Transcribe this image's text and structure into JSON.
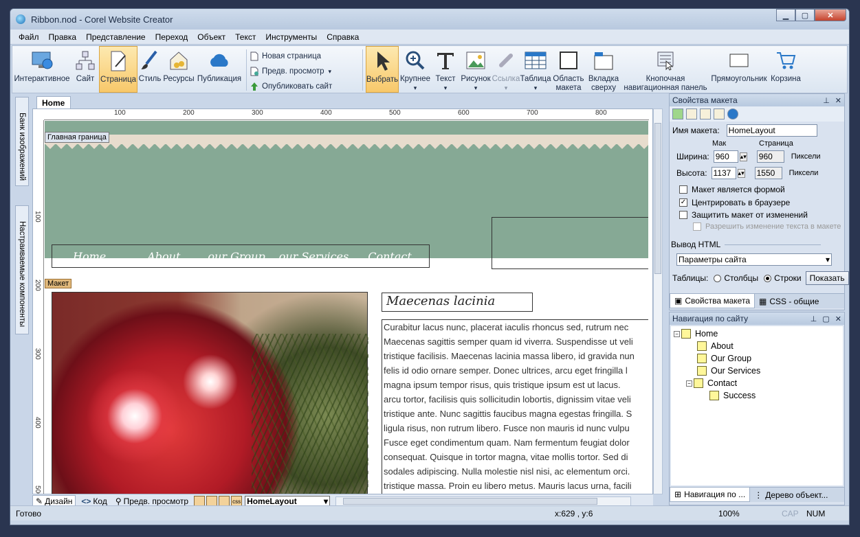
{
  "window": {
    "title": "Ribbon.nod - Corel Website Creator"
  },
  "menu": [
    "Файл",
    "Правка",
    "Представление",
    "Переход",
    "Объект",
    "Текст",
    "Инструменты",
    "Справка"
  ],
  "ribbon": {
    "left": [
      {
        "label": "Интерактивное",
        "icon": "monitor-globe-icon"
      },
      {
        "label": "Сайт",
        "icon": "sitemap-icon"
      },
      {
        "label": "Страница",
        "icon": "page-icon",
        "active": true
      },
      {
        "label": "Стиль",
        "icon": "brush-icon"
      },
      {
        "label": "Ресурсы",
        "icon": "house-coins-icon"
      },
      {
        "label": "Публикация",
        "icon": "cloud-icon"
      }
    ],
    "small": [
      {
        "label": "Новая страница"
      },
      {
        "label": "Предв. просмотр"
      },
      {
        "label": "Опубликовать сайт"
      }
    ],
    "right": [
      {
        "label": "Выбрать",
        "active": true
      },
      {
        "label": "Крупнее"
      },
      {
        "label": "Текст"
      },
      {
        "label": "Рисунок"
      },
      {
        "label": "Ссылка",
        "dim": true
      },
      {
        "label": "Таблица"
      },
      {
        "label": "Область макета"
      },
      {
        "label": "Вкладка сверху"
      },
      {
        "label": "Кнопочная навигационная панель"
      },
      {
        "label": "Прямоугольник"
      },
      {
        "label": "Корзина"
      }
    ]
  },
  "lefttabs": [
    "Банк изображений",
    "Настраиваемые компоненты"
  ],
  "doc": {
    "tab": "Home",
    "header_label": "Главная граница",
    "layout_label": "Макет",
    "ruler_h": [
      "100",
      "200",
      "300",
      "400",
      "500",
      "600",
      "700",
      "800"
    ],
    "ruler_v": [
      "100",
      "200",
      "300",
      "400",
      "500"
    ],
    "nav": [
      "Home",
      "About",
      "our Group",
      "our Services",
      "Contact"
    ],
    "heading": "Maecenas lacinia",
    "body": [
      "Curabitur lacus nunc, placerat iaculis rhoncus sed, rutrum nec",
      "Maecenas sagittis semper quam id viverra. Suspendisse ut veli",
      "tristique facilisis. Maecenas lacinia massa libero, id gravida nun",
      "felis id odio ornare semper. Donec ultrices, arcu eget fringilla l",
      "magna ipsum tempor risus, quis tristique ipsum est ut lacus.",
      "arcu tortor, facilisis quis sollicitudin lobortis, dignissim vitae veli",
      "tristique ante. Nunc sagittis faucibus magna egestas fringilla. S",
      "ligula risus, non rutrum libero. Fusce non mauris id nunc vulpu",
      "Fusce eget condimentum quam. Nam fermentum feugiat dolor",
      "consequat. Quisque in tortor magna, vitae mollis tortor. Sed di",
      "sodales adipiscing. Nulla molestie nisl nisi, ac elementum orci.",
      "tristique massa. Proin eu libero metus. Mauris lacus urna, facili"
    ]
  },
  "bottom": {
    "design": "Дизайн",
    "code": "Код",
    "preview": "Предв. просмотр",
    "layout_select": "HomeLayout"
  },
  "status": {
    "ready": "Готово",
    "coords": "x:629 , y:6",
    "zoom": "100%",
    "caps": "CAP",
    "num": "NUM"
  },
  "props": {
    "title": "Свойства макета",
    "name_label": "Имя макета:",
    "name_value": "HomeLayout",
    "max_label": "Мак",
    "page_label": "Страница",
    "width_label": "Ширина:",
    "width_max": "960",
    "width_page": "960",
    "height_label": "Высота:",
    "height_max": "1137",
    "height_page": "1550",
    "units": "Пиксели",
    "cb_form": "Макет является формой",
    "cb_center": "Центрировать в браузере",
    "cb_protect": "Защитить макет от изменений",
    "cb_allow": "Разрешить изменение текста в макете",
    "html_out": "Вывод HTML",
    "select": "Параметры сайта",
    "tables": "Таблицы:",
    "cols": "Столбцы",
    "rows": "Строки",
    "show": "Показать",
    "tab1": "Свойства макета",
    "tab2": "CSS - общие"
  },
  "nav_panel": {
    "title": "Навигация по сайту",
    "items": [
      "Home",
      "About",
      "Our Group",
      "Our Services",
      "Contact",
      "Success"
    ],
    "tab1": "Навигация по ...",
    "tab2": "Дерево объект..."
  }
}
